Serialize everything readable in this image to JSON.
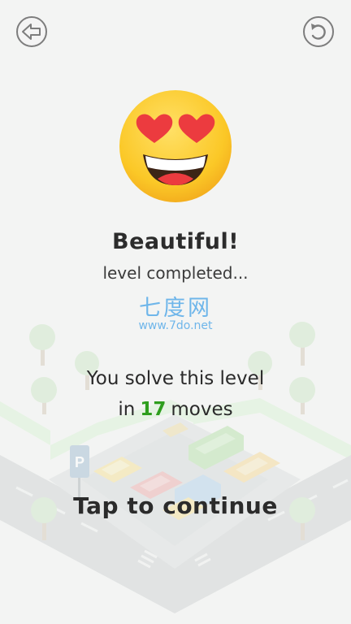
{
  "header": {
    "back_icon": "back-arrow-icon",
    "restart_icon": "restart-icon"
  },
  "result": {
    "emoji_icon": "heart-eyes-emoji-icon",
    "title": "Beautiful!",
    "subtitle": "level completed..."
  },
  "watermark": {
    "name": "七度网",
    "url": "www.7do.net"
  },
  "stats": {
    "line1": "You solve this level",
    "prefix": "in",
    "moves": "17",
    "suffix": "moves"
  },
  "actions": {
    "continue_label": "Tap to continue"
  },
  "colors": {
    "background": "#f1f2f1",
    "moves_number": "#2e9e1d",
    "watermark": "#6fb6ea",
    "emoji_face": "#fbc827",
    "heart": "#ec3b3f"
  }
}
